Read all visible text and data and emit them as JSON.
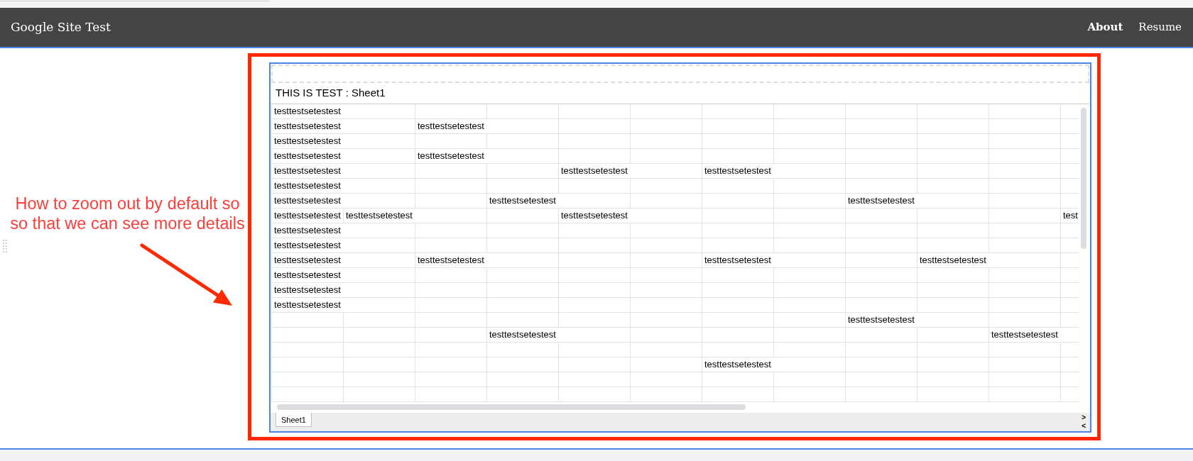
{
  "navbar": {
    "title": "Google Site Test",
    "links": [
      {
        "label": "About",
        "selected": true
      },
      {
        "label": "Resume",
        "selected": false
      }
    ]
  },
  "annotation": {
    "note": "How to zoom out by default so\nso that we can see more details"
  },
  "embed": {
    "title": "THIS IS TEST : Sheet1",
    "rows": [
      {
        "column_1": "testtestsetestest"
      },
      {
        "column_1": "testtestsetestest",
        "column_3": "testtestsetestest"
      },
      {
        "column_1": "testtestsetestest"
      },
      {
        "column_1": "testtestsetestest",
        "column_3": "testtestsetestest"
      },
      {
        "column_1": "testtestsetestest",
        "column_5": "testtestsetestest",
        "column_7": "testtestsetestest"
      },
      {
        "column_1": "testtestsetestest"
      },
      {
        "column_1": "testtestsetestest",
        "column_4": "testtestsetestest",
        "column_9": "testtestsetestest"
      },
      {
        "column_1": "testtestsetestest",
        "column_2": "testtestsetestest",
        "column_5": "testtestsetestest",
        "column_12": "test"
      },
      {
        "column_1": "testtestsetestest"
      },
      {
        "column_1": "testtestsetestest"
      },
      {
        "column_1": "testtestsetestest",
        "column_3": "testtestsetestest",
        "column_7": "testtestsetestest",
        "column_10": "testtestsetestest"
      },
      {
        "column_1": "testtestsetestest"
      },
      {
        "column_1": "testtestsetestest"
      },
      {
        "column_1": "testtestsetestest"
      },
      {
        "column_9": "testtestsetestest"
      },
      {
        "column_4": "testtestsetestest",
        "column_11": "testtestsetestest"
      },
      {},
      {
        "column_7": "testtestsetestest"
      },
      {},
      {}
    ],
    "sheet_tabs": [
      {
        "label": "Sheet1",
        "selected": true
      }
    ],
    "tab_scroll_buttons": [
      ">",
      "<"
    ]
  }
}
